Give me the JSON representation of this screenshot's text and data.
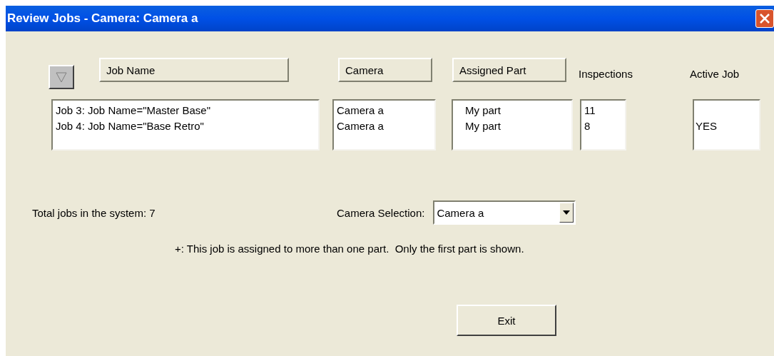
{
  "window": {
    "title": "Review Jobs - Camera: Camera a"
  },
  "columns": [
    {
      "label": "Job Name",
      "kind": "button"
    },
    {
      "label": "Camera",
      "kind": "button"
    },
    {
      "label": "Assigned Part",
      "kind": "button"
    },
    {
      "label": "Inspections",
      "kind": "label"
    },
    {
      "label": "Active Job",
      "kind": "label"
    }
  ],
  "jobs": [
    {
      "name": "Job 3: Job Name=\"Master Base\"",
      "camera": "Camera a",
      "part": "My part",
      "inspections": "11"
    },
    {
      "name": "Job 4: Job Name=\"Base Retro\"",
      "camera": "Camera a",
      "part": "My part",
      "inspections": "8",
      "active": "YES"
    }
  ],
  "total_jobs": "Total jobs in the system: 7",
  "camera_selection": {
    "label": "Camera Selection:",
    "value": "Camera a"
  },
  "note": "+: This job is assigned to more than one part.  Only the first part is shown.",
  "buttons": [
    "Exit"
  ]
}
